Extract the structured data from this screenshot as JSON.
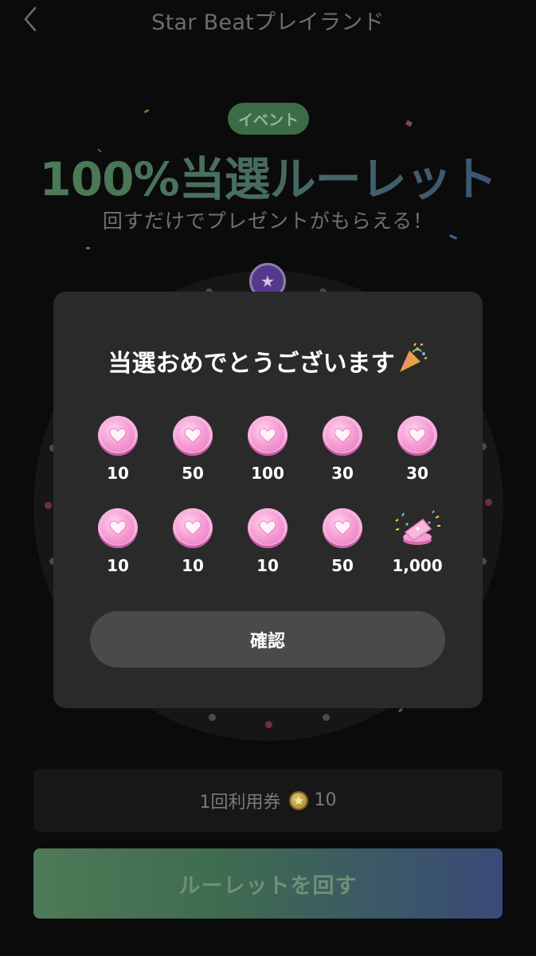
{
  "header": {
    "title": "Star Beatプレイランド"
  },
  "event": {
    "badge": "イベント",
    "title": "100%当選ルーレット",
    "subtitle": "回すだけでプレゼントがもらえる！"
  },
  "modal": {
    "title": "当選おめでとうございます",
    "prizes_row1": [
      {
        "icon": "heart-coin-icon",
        "amount": "10"
      },
      {
        "icon": "heart-coin-icon",
        "amount": "50"
      },
      {
        "icon": "heart-coin-icon",
        "amount": "100"
      },
      {
        "icon": "heart-coin-icon",
        "amount": "30"
      },
      {
        "icon": "heart-coin-icon",
        "amount": "30"
      }
    ],
    "prizes_row2": [
      {
        "icon": "heart-coin-icon",
        "amount": "10"
      },
      {
        "icon": "heart-coin-icon",
        "amount": "10"
      },
      {
        "icon": "heart-coin-icon",
        "amount": "10"
      },
      {
        "icon": "heart-coin-icon",
        "amount": "50"
      },
      {
        "icon": "ticket-icon",
        "amount": "1,000"
      }
    ],
    "confirm_label": "確認"
  },
  "ticket_bar": {
    "label": "1回利用券",
    "count": "10"
  },
  "spin_button": {
    "label": "ルーレットを回す"
  },
  "colors": {
    "accent_green": "#4d7e52",
    "accent_blue": "#3b4f7a",
    "coin_pink": "#f59bd3",
    "badge_green": "#3c6b48"
  }
}
